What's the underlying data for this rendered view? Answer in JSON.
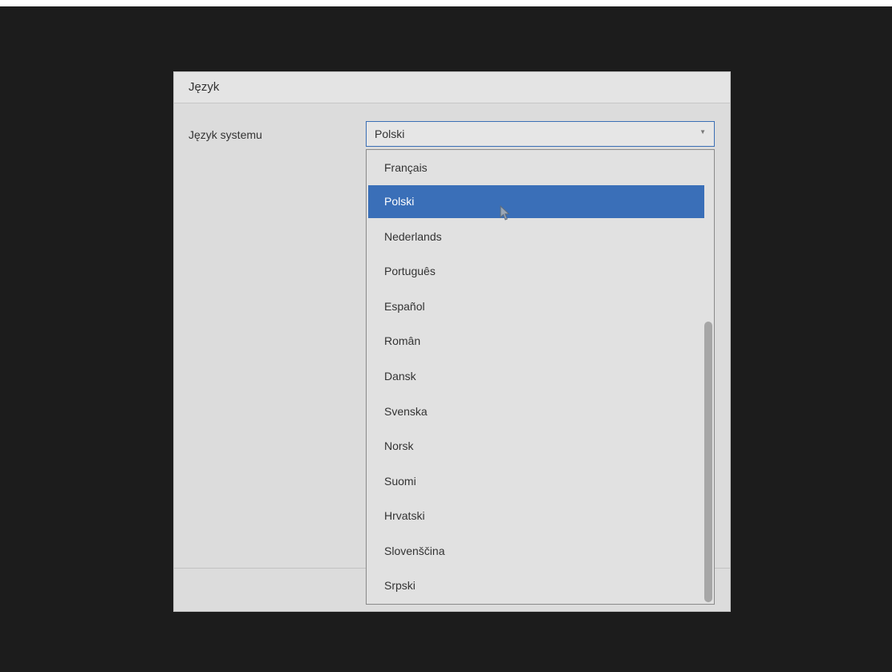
{
  "dialog": {
    "title": "Język",
    "language_label": "Język systemu",
    "select": {
      "value": "Polski"
    },
    "options": [
      {
        "label": "Français"
      },
      {
        "label": "Polski",
        "selected": true
      },
      {
        "label": "Nederlands"
      },
      {
        "label": "Português"
      },
      {
        "label": "Español"
      },
      {
        "label": "Român"
      },
      {
        "label": "Dansk"
      },
      {
        "label": "Svenska"
      },
      {
        "label": "Norsk"
      },
      {
        "label": "Suomi"
      },
      {
        "label": "Hrvatski"
      },
      {
        "label": "Slovenščina"
      },
      {
        "label": "Srpski"
      }
    ]
  },
  "colors": {
    "accent": "#3a6fb8",
    "background": "#1c1c1c",
    "dialog": "#dcdcdc"
  },
  "icons": {
    "arrow": "chevron-down-icon",
    "cursor": "mouse-pointer-icon"
  }
}
